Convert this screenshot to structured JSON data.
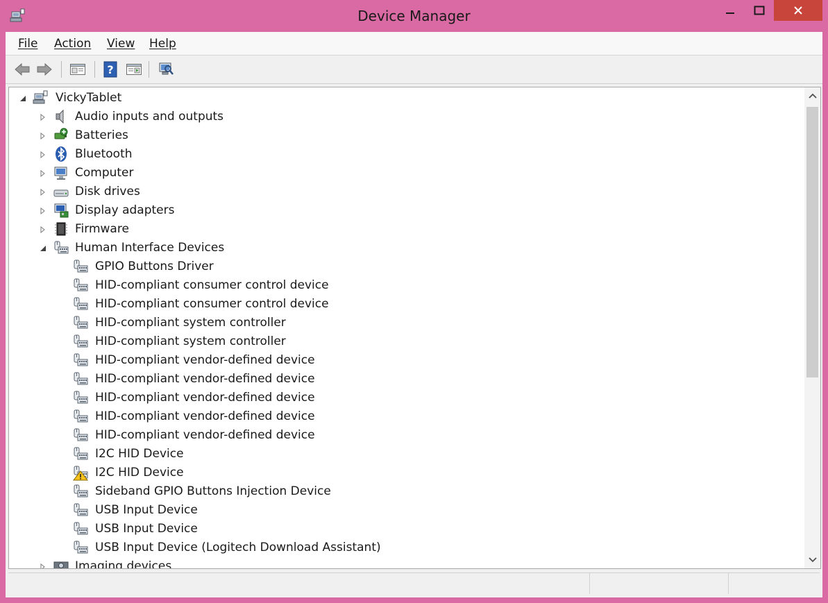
{
  "window": {
    "title": "Device Manager",
    "colors": {
      "frame": "#d96aa3",
      "close": "#c7453b"
    }
  },
  "menu": {
    "file": "File",
    "action": "Action",
    "view": "View",
    "help": "Help"
  },
  "toolbar": {
    "icons": [
      "back-arrow-icon",
      "forward-arrow-icon",
      "show-hide-console-tree-icon",
      "help-icon",
      "properties-icon",
      "scan-hardware-icon"
    ]
  },
  "tree": {
    "root": "VickyTablet",
    "categories": [
      {
        "label": "Audio inputs and outputs",
        "icon": "speaker-icon"
      },
      {
        "label": "Batteries",
        "icon": "battery-icon"
      },
      {
        "label": "Bluetooth",
        "icon": "bluetooth-icon"
      },
      {
        "label": "Computer",
        "icon": "computer-icon"
      },
      {
        "label": "Disk drives",
        "icon": "disk-drive-icon"
      },
      {
        "label": "Display adapters",
        "icon": "display-adapter-icon"
      },
      {
        "label": "Firmware",
        "icon": "firmware-chip-icon"
      },
      {
        "label": "Human Interface Devices",
        "icon": "hid-icon",
        "expanded": true
      }
    ],
    "hid_children": [
      {
        "label": "GPIO Buttons Driver",
        "warning": false
      },
      {
        "label": "HID-compliant consumer control device",
        "warning": false
      },
      {
        "label": "HID-compliant consumer control device",
        "warning": false
      },
      {
        "label": "HID-compliant system controller",
        "warning": false
      },
      {
        "label": "HID-compliant system controller",
        "warning": false
      },
      {
        "label": "HID-compliant vendor-defined device",
        "warning": false
      },
      {
        "label": "HID-compliant vendor-defined device",
        "warning": false
      },
      {
        "label": "HID-compliant vendor-defined device",
        "warning": false
      },
      {
        "label": "HID-compliant vendor-defined device",
        "warning": false
      },
      {
        "label": "HID-compliant vendor-defined device",
        "warning": false
      },
      {
        "label": "I2C HID Device",
        "warning": false
      },
      {
        "label": "I2C HID Device",
        "warning": true
      },
      {
        "label": "Sideband GPIO Buttons Injection Device",
        "warning": false
      },
      {
        "label": "USB Input Device",
        "warning": false
      },
      {
        "label": "USB Input Device",
        "warning": false
      },
      {
        "label": "USB Input Device (Logitech Download Assistant)",
        "warning": false
      }
    ],
    "next_category": {
      "label": "Imaging devices",
      "icon": "camera-icon"
    }
  }
}
